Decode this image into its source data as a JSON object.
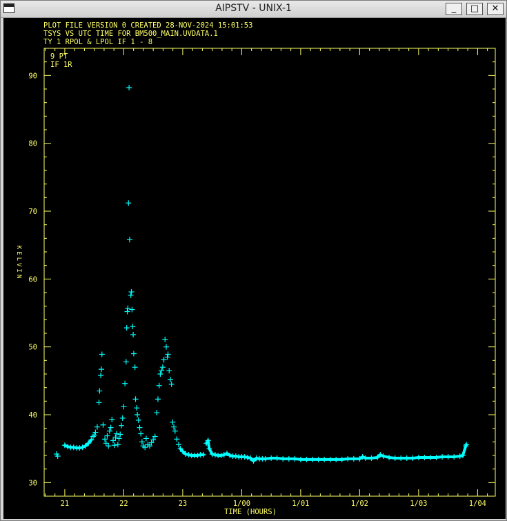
{
  "window": {
    "title": "AIPSTV - UNIX-1",
    "buttons": {
      "minimize": "_",
      "maximize": "□",
      "close": "✕"
    }
  },
  "plot": {
    "header_lines": [
      "PLOT FILE VERSION 0  CREATED 28-NOV-2024 15:01:53",
      "TSYS VS UTC TIME FOR BM500_MAIN.UVDATA.1",
      "TY 1  RPOL & LPOL  IF 1 - 8"
    ],
    "annotations": [
      "9 PT",
      "IF 1R"
    ],
    "colors": {
      "frame": "#ffff66",
      "points": "#00ffff",
      "background": "#000000"
    }
  },
  "chart_data": {
    "type": "scatter",
    "xlabel": "TIME (HOURS)",
    "ylabel": "KELVIN",
    "xlim": [
      20.65,
      28.3
    ],
    "ylim": [
      28,
      94
    ],
    "x_ticks": [
      {
        "value": 21,
        "label": "21"
      },
      {
        "value": 22,
        "label": "22"
      },
      {
        "value": 23,
        "label": "23"
      },
      {
        "value": 24,
        "label": "1/00"
      },
      {
        "value": 25,
        "label": "1/01"
      },
      {
        "value": 26,
        "label": "1/02"
      },
      {
        "value": 27,
        "label": "1/03"
      },
      {
        "value": 28,
        "label": "1/04"
      }
    ],
    "y_ticks": [
      30,
      40,
      50,
      60,
      70,
      80,
      90
    ],
    "points": [
      [
        20.86,
        34.2
      ],
      [
        20.88,
        33.9
      ],
      [
        21.0,
        35.5
      ],
      [
        21.05,
        35.3
      ],
      [
        21.1,
        35.2
      ],
      [
        21.15,
        35.2
      ],
      [
        21.2,
        35.1
      ],
      [
        21.25,
        35.1
      ],
      [
        21.3,
        35.2
      ],
      [
        21.35,
        35.4
      ],
      [
        21.4,
        35.8
      ],
      [
        21.45,
        36.3
      ],
      [
        21.48,
        36.8
      ],
      [
        21.5,
        37.0
      ],
      [
        21.52,
        37.4
      ],
      [
        21.55,
        38.2
      ],
      [
        21.58,
        41.8
      ],
      [
        21.59,
        43.5
      ],
      [
        21.61,
        45.8
      ],
      [
        21.62,
        46.7
      ],
      [
        21.63,
        48.9
      ],
      [
        21.65,
        38.5
      ],
      [
        21.68,
        36.4
      ],
      [
        21.7,
        35.8
      ],
      [
        21.72,
        36.9
      ],
      [
        21.74,
        35.4
      ],
      [
        21.76,
        37.6
      ],
      [
        21.78,
        38.1
      ],
      [
        21.8,
        39.3
      ],
      [
        21.82,
        36.2
      ],
      [
        21.84,
        35.5
      ],
      [
        21.86,
        36.7
      ],
      [
        21.88,
        37.2
      ],
      [
        21.9,
        35.6
      ],
      [
        21.92,
        36.5
      ],
      [
        21.94,
        37.1
      ],
      [
        21.96,
        38.4
      ],
      [
        21.98,
        39.5
      ],
      [
        22.0,
        41.2
      ],
      [
        22.02,
        44.6
      ],
      [
        22.04,
        47.8
      ],
      [
        22.05,
        52.8
      ],
      [
        22.06,
        55.2
      ],
      [
        22.07,
        55.7
      ],
      [
        22.08,
        71.2
      ],
      [
        22.09,
        88.2
      ],
      [
        22.1,
        65.8
      ],
      [
        22.12,
        57.6
      ],
      [
        22.13,
        58.1
      ],
      [
        22.14,
        55.5
      ],
      [
        22.15,
        53.0
      ],
      [
        22.16,
        51.8
      ],
      [
        22.17,
        49.0
      ],
      [
        22.19,
        47.0
      ],
      [
        22.2,
        42.3
      ],
      [
        22.22,
        41.0
      ],
      [
        22.23,
        40.0
      ],
      [
        22.25,
        39.2
      ],
      [
        22.27,
        38.1
      ],
      [
        22.29,
        37.2
      ],
      [
        22.31,
        36.0
      ],
      [
        22.33,
        35.4
      ],
      [
        22.36,
        35.2
      ],
      [
        22.38,
        36.5
      ],
      [
        22.41,
        35.6
      ],
      [
        22.44,
        35.4
      ],
      [
        22.47,
        35.9
      ],
      [
        22.5,
        36.3
      ],
      [
        22.53,
        36.8
      ],
      [
        22.56,
        40.3
      ],
      [
        22.58,
        42.3
      ],
      [
        22.6,
        44.3
      ],
      [
        22.62,
        46.0
      ],
      [
        22.64,
        46.5
      ],
      [
        22.66,
        47.0
      ],
      [
        22.68,
        48.1
      ],
      [
        22.7,
        51.1
      ],
      [
        22.72,
        50.0
      ],
      [
        22.74,
        48.5
      ],
      [
        22.75,
        48.9
      ],
      [
        22.77,
        46.5
      ],
      [
        22.79,
        45.2
      ],
      [
        22.81,
        44.5
      ],
      [
        22.83,
        38.9
      ],
      [
        22.85,
        38.2
      ],
      [
        22.87,
        37.6
      ],
      [
        22.9,
        36.4
      ],
      [
        22.93,
        35.6
      ],
      [
        22.96,
        35.0
      ],
      [
        23.0,
        34.6
      ],
      [
        23.05,
        34.2
      ],
      [
        23.1,
        34.1
      ],
      [
        23.15,
        34.0
      ],
      [
        23.2,
        34.0
      ],
      [
        23.25,
        34.0
      ],
      [
        23.3,
        34.1
      ],
      [
        23.35,
        34.1
      ],
      [
        23.4,
        35.8
      ],
      [
        23.43,
        36.2
      ],
      [
        23.45,
        35.0
      ],
      [
        23.5,
        34.2
      ],
      [
        23.55,
        34.1
      ],
      [
        23.6,
        34.0
      ],
      [
        23.65,
        34.0
      ],
      [
        23.7,
        34.1
      ],
      [
        23.75,
        34.3
      ],
      [
        23.8,
        34.0
      ],
      [
        23.85,
        33.9
      ],
      [
        23.9,
        33.9
      ],
      [
        23.95,
        33.8
      ],
      [
        24.0,
        33.8
      ],
      [
        24.05,
        33.8
      ],
      [
        24.1,
        33.7
      ],
      [
        24.15,
        33.6
      ],
      [
        24.2,
        33.2
      ],
      [
        24.25,
        33.6
      ],
      [
        24.3,
        33.5
      ],
      [
        24.35,
        33.5
      ],
      [
        24.4,
        33.5
      ],
      [
        24.5,
        33.6
      ],
      [
        24.6,
        33.6
      ],
      [
        24.7,
        33.5
      ],
      [
        24.8,
        33.5
      ],
      [
        24.9,
        33.5
      ],
      [
        25.0,
        33.4
      ],
      [
        25.1,
        33.4
      ],
      [
        25.2,
        33.4
      ],
      [
        25.3,
        33.4
      ],
      [
        25.4,
        33.4
      ],
      [
        25.5,
        33.4
      ],
      [
        25.6,
        33.4
      ],
      [
        25.7,
        33.4
      ],
      [
        25.8,
        33.5
      ],
      [
        25.9,
        33.5
      ],
      [
        26.0,
        33.5
      ],
      [
        26.05,
        33.8
      ],
      [
        26.1,
        33.6
      ],
      [
        26.2,
        33.6
      ],
      [
        26.3,
        33.7
      ],
      [
        26.35,
        34.1
      ],
      [
        26.4,
        33.9
      ],
      [
        26.5,
        33.7
      ],
      [
        26.6,
        33.6
      ],
      [
        26.7,
        33.6
      ],
      [
        26.8,
        33.6
      ],
      [
        26.9,
        33.6
      ],
      [
        27.0,
        33.7
      ],
      [
        27.1,
        33.7
      ],
      [
        27.2,
        33.7
      ],
      [
        27.3,
        33.7
      ],
      [
        27.4,
        33.8
      ],
      [
        27.5,
        33.8
      ],
      [
        27.6,
        33.8
      ],
      [
        27.7,
        33.9
      ],
      [
        27.75,
        34.0
      ],
      [
        27.8,
        35.4
      ],
      [
        27.81,
        35.6
      ]
    ]
  }
}
